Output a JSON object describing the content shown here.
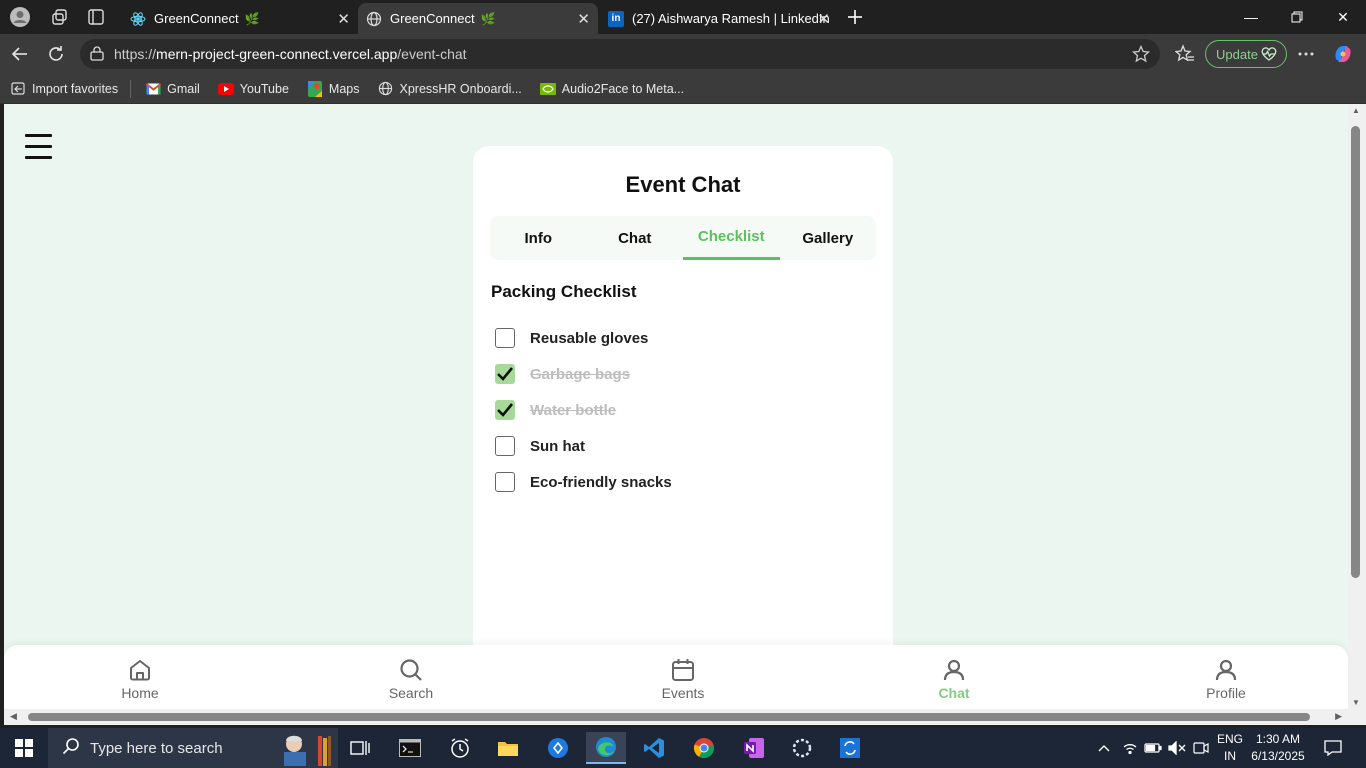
{
  "browser": {
    "tabs": [
      {
        "title": "GreenConnect",
        "leaf": "🌿"
      },
      {
        "title": "GreenConnect",
        "leaf": "🌿"
      },
      {
        "title": "(27) Aishwarya Ramesh | LinkedIn"
      }
    ],
    "url_scheme": "https://",
    "url_host": "mern-project-green-connect.vercel.app",
    "url_path": "/event-chat",
    "update_label": "Update",
    "bookmarks": [
      {
        "label": "Import favorites",
        "icon": "import-icon"
      },
      {
        "label": "Gmail",
        "icon": "gmail-icon"
      },
      {
        "label": "YouTube",
        "icon": "youtube-icon"
      },
      {
        "label": "Maps",
        "icon": "maps-icon"
      },
      {
        "label": "XpressHR Onboardi...",
        "icon": "globe-icon"
      },
      {
        "label": "Audio2Face to Meta...",
        "icon": "nvidia-icon"
      }
    ]
  },
  "page": {
    "title": "Event Chat",
    "tabs": [
      "Info",
      "Chat",
      "Checklist",
      "Gallery"
    ],
    "active_tab": "Checklist",
    "accent_color": "#5cc15c",
    "checklist": {
      "title": "Packing Checklist",
      "items": [
        {
          "label": "Reusable gloves",
          "checked": false
        },
        {
          "label": "Garbage bags",
          "checked": true
        },
        {
          "label": "Water bottle",
          "checked": true
        },
        {
          "label": "Sun hat",
          "checked": false
        },
        {
          "label": "Eco-friendly snacks",
          "checked": false
        }
      ]
    },
    "bottom_nav": [
      {
        "label": "Home",
        "icon": "home-icon"
      },
      {
        "label": "Search",
        "icon": "search-icon"
      },
      {
        "label": "Events",
        "icon": "calendar-icon"
      },
      {
        "label": "Chat",
        "icon": "user-icon",
        "active": true
      },
      {
        "label": "Profile",
        "icon": "user-icon"
      }
    ]
  },
  "taskbar": {
    "search_placeholder": "Type here to search",
    "lang_line1": "ENG",
    "lang_line2": "IN",
    "time": "1:30 AM",
    "date": "6/13/2025"
  }
}
